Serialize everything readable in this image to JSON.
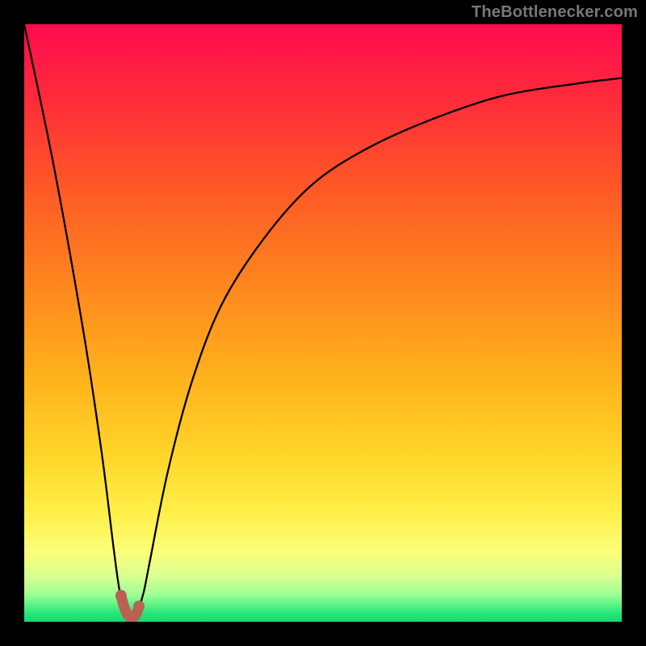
{
  "attribution": "TheBottlenecker.com",
  "chart_data": {
    "type": "line",
    "title": "",
    "xlabel": "",
    "ylabel": "",
    "xlim": [
      0,
      100
    ],
    "ylim": [
      0,
      100
    ],
    "series": [
      {
        "name": "bottleneck-curve",
        "x": [
          0,
          5,
          10,
          13,
          15,
          16,
          17,
          18,
          19,
          20,
          21,
          24,
          28,
          33,
          40,
          48,
          57,
          68,
          80,
          92,
          100
        ],
        "values": [
          100,
          76,
          48,
          28,
          12,
          5,
          2,
          1,
          2,
          5,
          10,
          25,
          40,
          53,
          64,
          73,
          79,
          84,
          88,
          90,
          91
        ]
      }
    ],
    "highlight_region": {
      "x_start": 16.2,
      "x_end": 19.2
    },
    "gradient_stops": [
      {
        "offset": 0.0,
        "color": "#ff0b4f"
      },
      {
        "offset": 0.12,
        "color": "#ff2a3a"
      },
      {
        "offset": 0.28,
        "color": "#ff5a26"
      },
      {
        "offset": 0.45,
        "color": "#ff8a1e"
      },
      {
        "offset": 0.6,
        "color": "#ffb41c"
      },
      {
        "offset": 0.73,
        "color": "#ffd82a"
      },
      {
        "offset": 0.82,
        "color": "#fff04a"
      },
      {
        "offset": 0.885,
        "color": "#fbff7a"
      },
      {
        "offset": 0.925,
        "color": "#d7ff90"
      },
      {
        "offset": 0.955,
        "color": "#9cff96"
      },
      {
        "offset": 0.985,
        "color": "#27e87a"
      },
      {
        "offset": 1.0,
        "color": "#18d76e"
      }
    ]
  }
}
